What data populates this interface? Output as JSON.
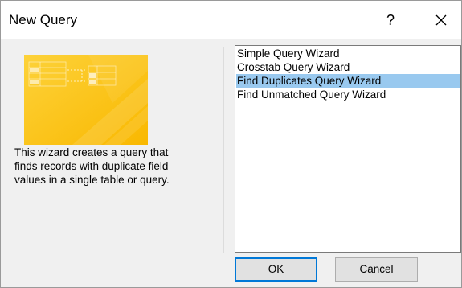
{
  "dialog": {
    "title": "New Query",
    "help_label": "?",
    "close_icon": "close-icon"
  },
  "wizard_list": {
    "items": [
      {
        "label": "Simple Query Wizard",
        "selected": false
      },
      {
        "label": "Crosstab Query Wizard",
        "selected": false
      },
      {
        "label": "Find Duplicates Query Wizard",
        "selected": true
      },
      {
        "label": "Find Unmatched Query Wizard",
        "selected": false
      }
    ]
  },
  "description": {
    "lines": [
      "This wizard creates a query that",
      "finds records with duplicate field",
      "values in a single table or query."
    ]
  },
  "buttons": {
    "ok_label": "OK",
    "cancel_label": "Cancel"
  },
  "colors": {
    "selection": "#99c9ef",
    "preview_yellow": "#fcc419",
    "default_button_border": "#0078d7"
  }
}
